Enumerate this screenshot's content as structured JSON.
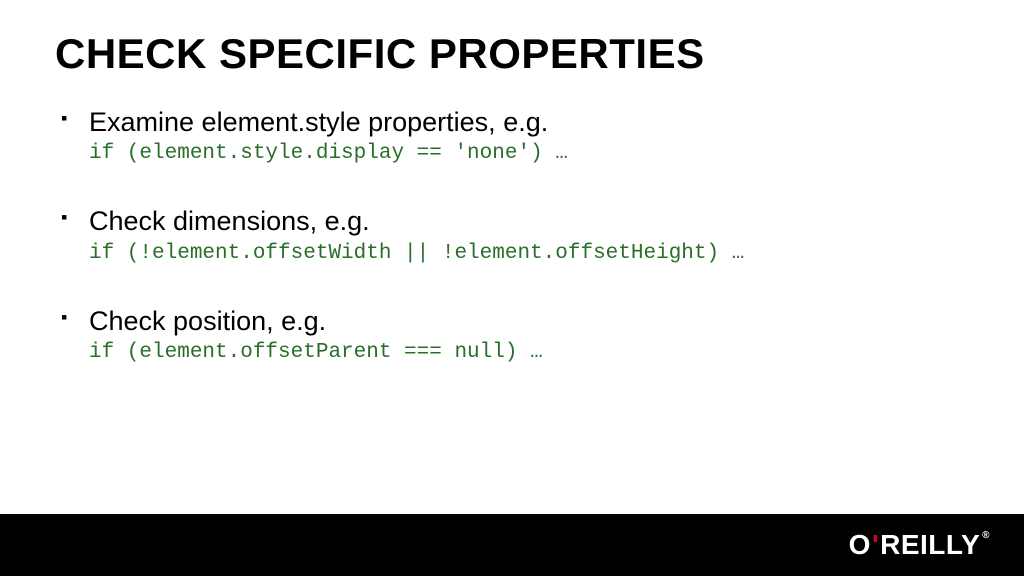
{
  "slide": {
    "title": "CHECK SPECIFIC PROPERTIES",
    "bullets": [
      {
        "text": "Examine element.style properties, e.g.",
        "code": "if (element.style.display == 'none') …"
      },
      {
        "text": "Check dimensions, e.g.",
        "code": "if (!element.offsetWidth || !element.offsetHeight) …"
      },
      {
        "text": "Check position, e.g.",
        "code": "if (element.offsetParent === null) …"
      }
    ]
  },
  "footer": {
    "brand_left": "O",
    "brand_apostrophe": "'",
    "brand_right": "REILLY",
    "reg_mark": "®"
  }
}
